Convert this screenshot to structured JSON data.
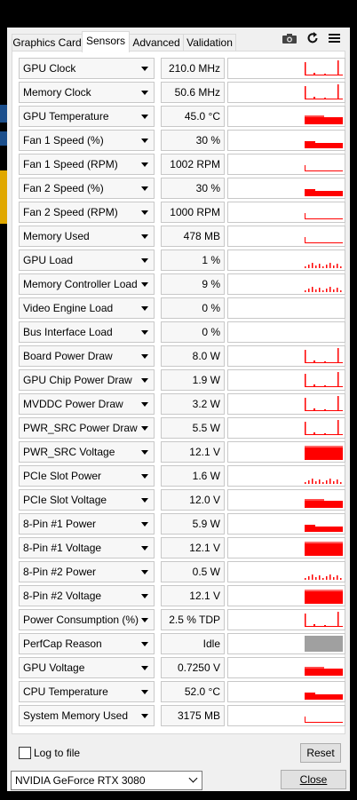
{
  "tabs": [
    {
      "label": "Graphics Card"
    },
    {
      "label": "Sensors"
    },
    {
      "label": "Advanced"
    },
    {
      "label": "Validation"
    }
  ],
  "icons": {
    "camera": "camera-icon",
    "refresh": "refresh-icon",
    "menu": "hamburger-menu-icon"
  },
  "colors": {
    "graph": "#ff0000",
    "perfcap": "#a0a0a0"
  },
  "sensors": [
    {
      "label": "GPU Clock",
      "value": "210.0 MHz",
      "graph": "spikes"
    },
    {
      "label": "Memory Clock",
      "value": "50.6 MHz",
      "graph": "spikes"
    },
    {
      "label": "GPU Temperature",
      "value": "45.0 °C",
      "graph": "high"
    },
    {
      "label": "Fan 1 Speed (%)",
      "value": "30 %",
      "graph": "mid"
    },
    {
      "label": "Fan 1 Speed (RPM)",
      "value": "1002 RPM",
      "graph": "low"
    },
    {
      "label": "Fan 2 Speed (%)",
      "value": "30 %",
      "graph": "mid"
    },
    {
      "label": "Fan 2 Speed (RPM)",
      "value": "1000 RPM",
      "graph": "low"
    },
    {
      "label": "Memory Used",
      "value": "478 MB",
      "graph": "low"
    },
    {
      "label": "GPU Load",
      "value": "1 %",
      "graph": "noise"
    },
    {
      "label": "Memory Controller Load",
      "value": "9 %",
      "graph": "noise"
    },
    {
      "label": "Video Engine Load",
      "value": "0 %",
      "graph": "none"
    },
    {
      "label": "Bus Interface Load",
      "value": "0 %",
      "graph": "none"
    },
    {
      "label": "Board Power Draw",
      "value": "8.0 W",
      "graph": "spikes"
    },
    {
      "label": "GPU Chip Power Draw",
      "value": "1.9 W",
      "graph": "spikes"
    },
    {
      "label": "MVDDC Power Draw",
      "value": "3.2 W",
      "graph": "spikes"
    },
    {
      "label": "PWR_SRC Power Draw",
      "value": "5.5 W",
      "graph": "spikes"
    },
    {
      "label": "PWR_SRC Voltage",
      "value": "12.1 V",
      "graph": "full"
    },
    {
      "label": "PCIe Slot Power",
      "value": "1.6 W",
      "graph": "noise"
    },
    {
      "label": "PCIe Slot Voltage",
      "value": "12.0 V",
      "graph": "high"
    },
    {
      "label": "8-Pin #1 Power",
      "value": "5.9 W",
      "graph": "mid"
    },
    {
      "label": "8-Pin #1 Voltage",
      "value": "12.1 V",
      "graph": "full"
    },
    {
      "label": "8-Pin #2 Power",
      "value": "0.5 W",
      "graph": "noise"
    },
    {
      "label": "8-Pin #2 Voltage",
      "value": "12.1 V",
      "graph": "full"
    },
    {
      "label": "Power Consumption (%)",
      "value": "2.5 % TDP",
      "graph": "spikes"
    },
    {
      "label": "PerfCap Reason",
      "value": "Idle",
      "graph": "gray"
    },
    {
      "label": "GPU Voltage",
      "value": "0.7250 V",
      "graph": "high"
    },
    {
      "label": "CPU Temperature",
      "value": "52.0 °C",
      "graph": "mid"
    },
    {
      "label": "System Memory Used",
      "value": "3175 MB",
      "graph": "low"
    }
  ],
  "footer": {
    "log_label": "Log to file",
    "reset_label": "Reset",
    "gpu_select": "NVIDIA GeForce RTX 3080",
    "close_label": "Close"
  }
}
